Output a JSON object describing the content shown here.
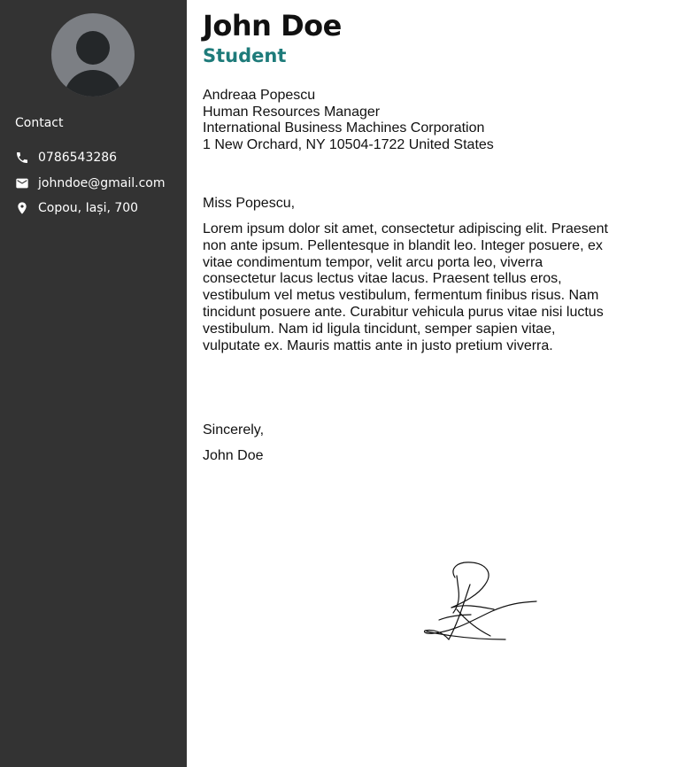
{
  "sidebar": {
    "contact_title": "Contact",
    "contacts": [
      {
        "icon": "phone-icon",
        "text": "0786543286"
      },
      {
        "icon": "mail-icon",
        "text": "johndoe@gmail.com"
      },
      {
        "icon": "location-pin-icon",
        "text": "Copou, Iași, 700"
      }
    ]
  },
  "header": {
    "name": "John Doe",
    "role": "Student"
  },
  "recipient": {
    "lines": [
      "Andreaa Popescu",
      "Human Resources Manager",
      "International Business Machines Corporation",
      "1 New Orchard, NY 10504-1722 United States"
    ]
  },
  "letter": {
    "greeting": "Miss Popescu,",
    "body": "Lorem ipsum dolor sit amet, consectetur adipiscing elit. Praesent non ante ipsum. Pellentesque in blandit leo. Integer posuere, ex vitae condimentum tempor, velit arcu porta leo, viverra consectetur lacus lectus vitae lacus. Praesent tellus eros, vestibulum vel metus vestibulum, fermentum finibus risus. Nam tincidunt posuere ante. Curabitur vehicula purus vitae nisi luctus vestibulum. Nam id ligula tincidunt, semper sapien vitae, vulputate ex. Mauris mattis ante in justo pretium viverra.",
    "closing": "Sincerely,",
    "signer": "John Doe"
  },
  "colors": {
    "sidebar_bg": "#333333",
    "accent": "#1e7b7a",
    "avatar_bg": "#7c7f84"
  }
}
